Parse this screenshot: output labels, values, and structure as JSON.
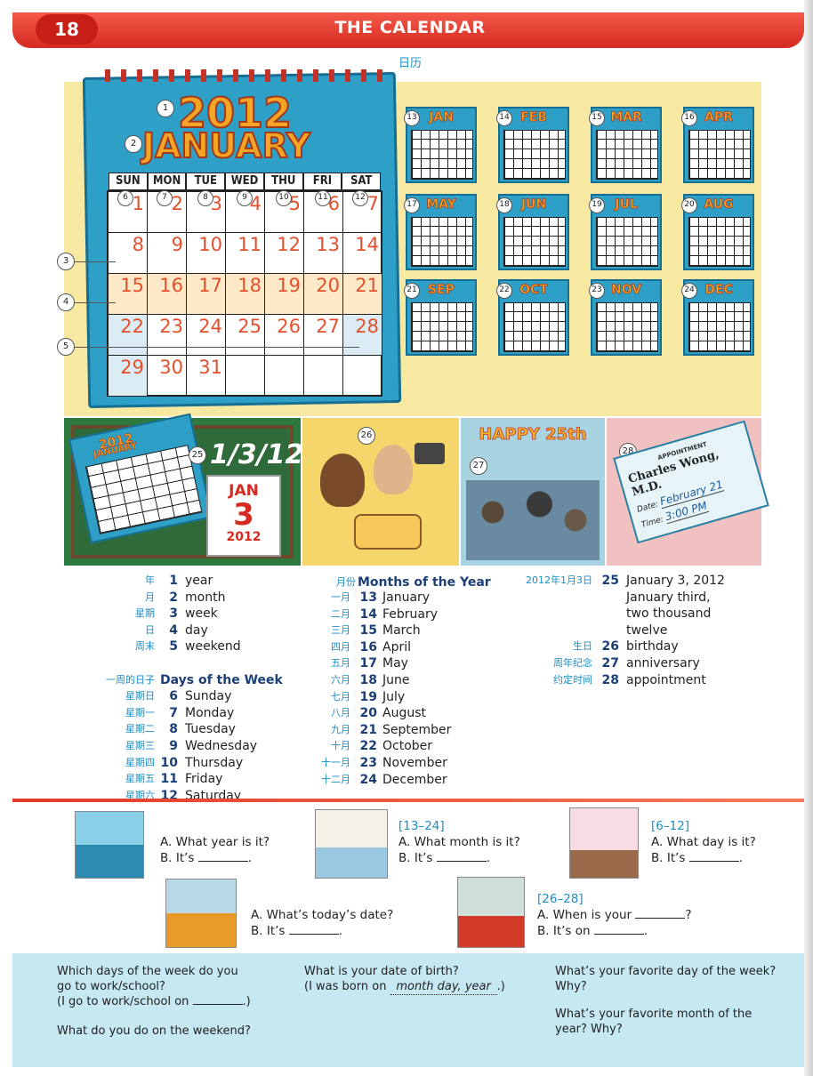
{
  "header": {
    "page_number": "18",
    "title": "THE CALENDAR",
    "subtitle": "日历"
  },
  "big_calendar": {
    "year": "2012",
    "month": "JANUARY",
    "days_of_week": [
      "SUN",
      "MON",
      "TUE",
      "WED",
      "THU",
      "FRI",
      "SAT"
    ],
    "weeks": [
      [
        "1",
        "2",
        "3",
        "4",
        "5",
        "6",
        "7"
      ],
      [
        "8",
        "9",
        "10",
        "11",
        "12",
        "13",
        "14"
      ],
      [
        "15",
        "16",
        "17",
        "18",
        "19",
        "20",
        "21"
      ],
      [
        "22",
        "23",
        "24",
        "25",
        "26",
        "27",
        "28"
      ],
      [
        "29",
        "30",
        "31",
        "",
        "",
        "",
        ""
      ]
    ],
    "callouts": [
      "1",
      "2",
      "3",
      "4",
      "5",
      "6",
      "7",
      "8",
      "9",
      "10",
      "11",
      "12"
    ]
  },
  "month_calendars": [
    {
      "num": "13",
      "label": "JAN"
    },
    {
      "num": "14",
      "label": "FEB"
    },
    {
      "num": "15",
      "label": "MAR"
    },
    {
      "num": "16",
      "label": "APR"
    },
    {
      "num": "17",
      "label": "MAY"
    },
    {
      "num": "18",
      "label": "JUN"
    },
    {
      "num": "19",
      "label": "JUL"
    },
    {
      "num": "20",
      "label": "AUG"
    },
    {
      "num": "21",
      "label": "SEP"
    },
    {
      "num": "22",
      "label": "OCT"
    },
    {
      "num": "23",
      "label": "NOV"
    },
    {
      "num": "24",
      "label": "DEC"
    }
  ],
  "illustrations": {
    "p25": {
      "num": "25",
      "date": "1/3/12",
      "small_cal_year": "2012",
      "small_cal_month": "JANUARY",
      "card_month": "JAN",
      "card_day": "3",
      "card_year": "2012"
    },
    "p26": {
      "num": "26"
    },
    "p27": {
      "num": "27",
      "banner": "HAPPY 25th"
    },
    "p28": {
      "num": "28",
      "card_header": "APPOINTMENT",
      "doctor": "Charles Wong, M.D.",
      "date_label": "Date:",
      "date_value": "February 21",
      "time_label": "Time:",
      "time_value": "3:00 PM"
    }
  },
  "vocab_col1": [
    {
      "zh": "年",
      "num": "1",
      "en": "year"
    },
    {
      "zh": "月",
      "num": "2",
      "en": "month"
    },
    {
      "zh": "星期",
      "num": "3",
      "en": "week"
    },
    {
      "zh": "日",
      "num": "4",
      "en": "day"
    },
    {
      "zh": "周末",
      "num": "5",
      "en": "weekend"
    }
  ],
  "days_heading": {
    "zh": "一周的日子",
    "en": "Days of the Week"
  },
  "vocab_days": [
    {
      "zh": "星期日",
      "num": "6",
      "en": "Sunday"
    },
    {
      "zh": "星期一",
      "num": "7",
      "en": "Monday"
    },
    {
      "zh": "星期二",
      "num": "8",
      "en": "Tuesday"
    },
    {
      "zh": "星期三",
      "num": "9",
      "en": "Wednesday"
    },
    {
      "zh": "星期四",
      "num": "10",
      "en": "Thursday"
    },
    {
      "zh": "星期五",
      "num": "11",
      "en": "Friday"
    },
    {
      "zh": "星期六",
      "num": "12",
      "en": "Saturday"
    }
  ],
  "months_heading": {
    "zh": "月份",
    "en": "Months of the Year"
  },
  "vocab_months": [
    {
      "zh": "一月",
      "num": "13",
      "en": "January"
    },
    {
      "zh": "二月",
      "num": "14",
      "en": "February"
    },
    {
      "zh": "三月",
      "num": "15",
      "en": "March"
    },
    {
      "zh": "四月",
      "num": "16",
      "en": "April"
    },
    {
      "zh": "五月",
      "num": "17",
      "en": "May"
    },
    {
      "zh": "六月",
      "num": "18",
      "en": "June"
    },
    {
      "zh": "七月",
      "num": "19",
      "en": "July"
    },
    {
      "zh": "八月",
      "num": "20",
      "en": "August"
    },
    {
      "zh": "九月",
      "num": "21",
      "en": "September"
    },
    {
      "zh": "十月",
      "num": "22",
      "en": "October"
    },
    {
      "zh": "十一月",
      "num": "23",
      "en": "November"
    },
    {
      "zh": "十二月",
      "num": "24",
      "en": "December"
    }
  ],
  "vocab_col3": [
    {
      "zh": "2012年1月3日",
      "num": "25",
      "en": "January 3, 2012"
    },
    {
      "zh": "",
      "num": "",
      "en": "January third,"
    },
    {
      "zh": "",
      "num": "",
      "en": "  two thousand"
    },
    {
      "zh": "",
      "num": "",
      "en": "  twelve"
    },
    {
      "zh": "生日",
      "num": "26",
      "en": "birthday"
    },
    {
      "zh": "周年纪念",
      "num": "27",
      "en": "anniversary"
    },
    {
      "zh": "约定时间",
      "num": "28",
      "en": "appointment"
    }
  ],
  "questions": {
    "q1": {
      "a": "A. What year is it?",
      "b": "B. It’s"
    },
    "q2": {
      "tag": "[13–24]",
      "a": "A. What month is it?",
      "b": "B. It’s"
    },
    "q3": {
      "tag": "[6–12]",
      "a": "A. What day is it?",
      "b": "B. It’s"
    },
    "q4": {
      "a": "A. What’s today’s date?",
      "b": "B. It’s"
    },
    "q5": {
      "tag": "[26–28]",
      "a": "A. When is your",
      "a_end": "?",
      "b": "B. It’s on"
    }
  },
  "footer": {
    "c1_l1": "Which days of the week do you",
    "c1_l2": "go to work/school?",
    "c1_l3": "(I go to work/school on",
    "c1_l3_end": ".)",
    "c1_l4": "What do you do on the weekend?",
    "c2_l1": "What is your date of birth?",
    "c2_l2": "(I was born on",
    "c2_fill": "month day, year",
    "c2_end": ".)",
    "c3_l1": "What’s your favorite day of the week?",
    "c3_l2": "Why?",
    "c3_l3": "What’s your favorite month of the",
    "c3_l4": "year?  Why?"
  },
  "colors": {
    "header_red": "#d42a20",
    "accent_blue": "#1a8ec8",
    "number_navy": "#1d3f78",
    "calendar_blue": "#2ea0c8",
    "date_orange": "#e2502c",
    "footer_blue": "#c6e8f3"
  }
}
